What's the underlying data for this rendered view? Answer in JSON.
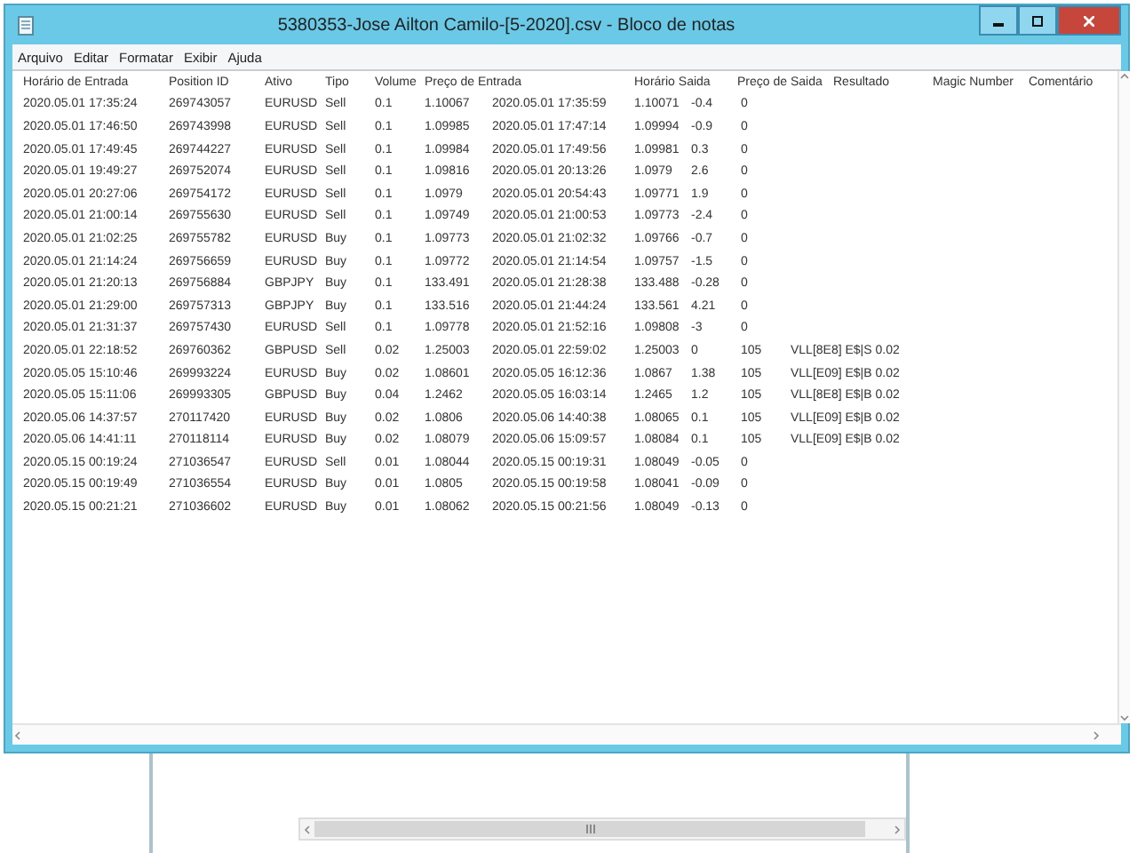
{
  "window": {
    "title": "5380353-Jose Ailton Camilo-[5-2020].csv - Bloco de notas"
  },
  "menu": [
    "Arquivo",
    "Editar",
    "Formatar",
    "Exibir",
    "Ajuda"
  ],
  "header": [
    "Horário de Entrada",
    "Position ID",
    "Ativo",
    "Tipo",
    "Volume",
    "Preço de Entrada",
    "Horário Saida",
    "Preço de Saida",
    "Resultado",
    "Magic Number",
    "Comentário"
  ],
  "rows": [
    [
      "2020.05.01 17:35:24",
      "269743057",
      "EURUSD",
      "Sell",
      "0.1",
      "1.10067",
      "2020.05.01 17:35:59",
      "1.10071",
      "-0.4",
      "0"
    ],
    [
      "2020.05.01 17:46:50",
      "269743998",
      "EURUSD",
      "Sell",
      "0.1",
      "1.09985",
      "2020.05.01 17:47:14",
      "1.09994",
      "-0.9",
      "0"
    ],
    [
      "2020.05.01 17:49:45",
      "269744227",
      "EURUSD",
      "Sell",
      "0.1",
      "1.09984",
      "2020.05.01 17:49:56",
      "1.09981",
      "0.3",
      "0"
    ],
    [
      "2020.05.01 19:49:27",
      "269752074",
      "EURUSD",
      "Sell",
      "0.1",
      "1.09816",
      "2020.05.01 20:13:26",
      "1.0979",
      "2.6",
      "0"
    ],
    [
      "2020.05.01 20:27:06",
      "269754172",
      "EURUSD",
      "Sell",
      "0.1",
      "1.0979",
      "2020.05.01 20:54:43",
      "1.09771",
      "1.9",
      "0"
    ],
    [
      "2020.05.01 21:00:14",
      "269755630",
      "EURUSD",
      "Sell",
      "0.1",
      "1.09749",
      "2020.05.01 21:00:53",
      "1.09773",
      "-2.4",
      "0"
    ],
    [
      "2020.05.01 21:02:25",
      "269755782",
      "EURUSD",
      "Buy",
      "0.1",
      "1.09773",
      "2020.05.01 21:02:32",
      "1.09766",
      "-0.7",
      "0"
    ],
    [
      "2020.05.01 21:14:24",
      "269756659",
      "EURUSD",
      "Buy",
      "0.1",
      "1.09772",
      "2020.05.01 21:14:54",
      "1.09757",
      "-1.5",
      "0"
    ],
    [
      "2020.05.01 21:20:13",
      "269756884",
      "GBPJPY",
      "Buy",
      "0.1",
      "133.491",
      "2020.05.01 21:28:38",
      "133.488",
      "-0.28",
      "0"
    ],
    [
      "2020.05.01 21:29:00",
      "269757313",
      "GBPJPY",
      "Buy",
      "0.1",
      "133.516",
      "2020.05.01 21:44:24",
      "133.561",
      "4.21",
      "0"
    ],
    [
      "2020.05.01 21:31:37",
      "269757430",
      "EURUSD",
      "Sell",
      "0.1",
      "1.09778",
      "2020.05.01 21:52:16",
      "1.09808",
      "-3",
      "0"
    ],
    [
      "2020.05.01 22:18:52",
      "269760362",
      "GBPUSD",
      "Sell",
      "0.02",
      "1.25003",
      "2020.05.01 22:59:02",
      "1.25003",
      "0",
      "105",
      "VLL[8E8] E$|S 0.02"
    ],
    [
      "2020.05.05 15:10:46",
      "269993224",
      "EURUSD",
      "Buy",
      "0.02",
      "1.08601",
      "2020.05.05 16:12:36",
      "1.0867",
      "1.38",
      "105",
      "VLL[E09] E$|B 0.02"
    ],
    [
      "2020.05.05 15:11:06",
      "269993305",
      "GBPUSD",
      "Buy",
      "0.04",
      "1.2462",
      "2020.05.05 16:03:14",
      "1.2465",
      "1.2",
      "105",
      "VLL[8E8] E$|B 0.02"
    ],
    [
      "2020.05.06 14:37:57",
      "270117420",
      "EURUSD",
      "Buy",
      "0.02",
      "1.0806",
      "2020.05.06 14:40:38",
      "1.08065",
      "0.1",
      "105",
      "VLL[E09] E$|B 0.02"
    ],
    [
      "2020.05.06 14:41:11",
      "270118114",
      "EURUSD",
      "Buy",
      "0.02",
      "1.08079",
      "2020.05.06 15:09:57",
      "1.08084",
      "0.1",
      "105",
      "VLL[E09] E$|B 0.02"
    ],
    [
      "2020.05.15 00:19:24",
      "271036547",
      "EURUSD",
      "Sell",
      "0.01",
      "1.08044",
      "2020.05.15 00:19:31",
      "1.08049",
      "-0.05",
      "0"
    ],
    [
      "2020.05.15 00:19:49",
      "271036554",
      "EURUSD",
      "Buy",
      "0.01",
      "1.0805",
      "2020.05.15 00:19:58",
      "1.08041",
      "-0.09",
      "0"
    ],
    [
      "2020.05.15 00:21:21",
      "271036602",
      "EURUSD",
      "Buy",
      "0.01",
      "1.08062",
      "2020.05.15 00:21:56",
      "1.08049",
      "-0.13",
      "0"
    ]
  ]
}
